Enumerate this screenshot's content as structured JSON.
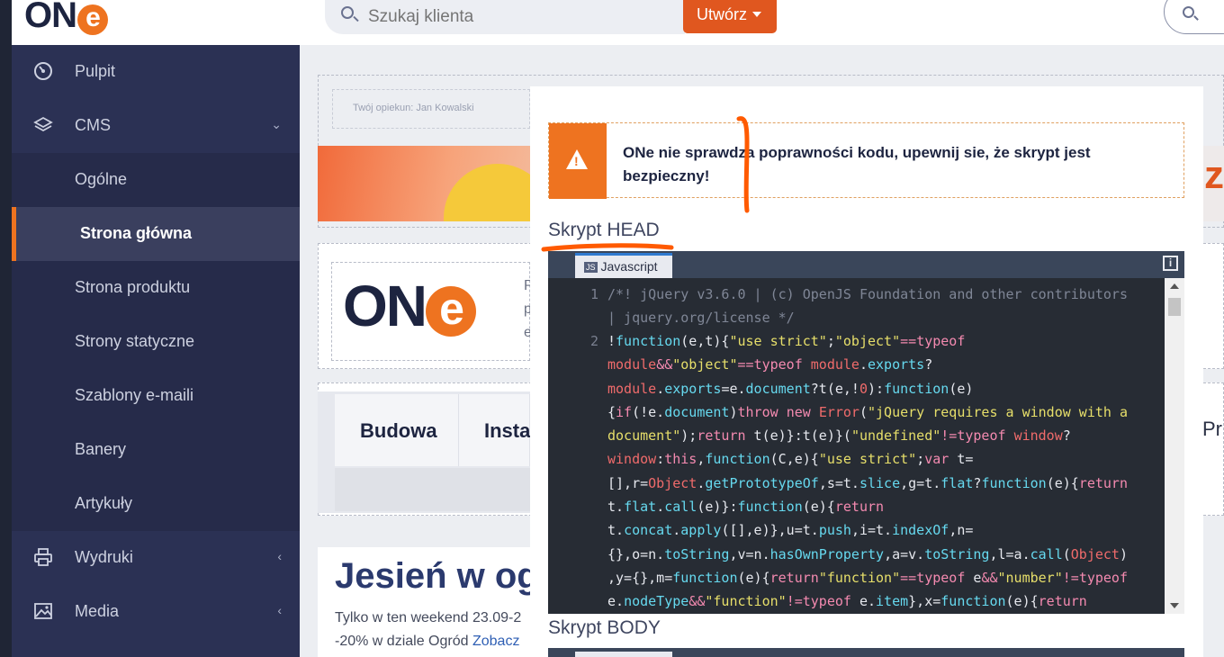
{
  "app": {
    "logo_main": "ON",
    "logo_e": "e"
  },
  "header": {
    "search_placeholder": "Szukaj klienta",
    "create_label": "Utwórz"
  },
  "sidebar": {
    "items": [
      {
        "label": "Pulpit",
        "icon": "dashboard-gauge-icon"
      },
      {
        "label": "CMS",
        "icon": "layers-icon"
      },
      {
        "label": "Ogólne"
      },
      {
        "label": "Strona główna"
      },
      {
        "label": "Strona produktu"
      },
      {
        "label": "Strony statyczne"
      },
      {
        "label": "Szablony e-maili"
      },
      {
        "label": "Banery"
      },
      {
        "label": "Artykuły"
      },
      {
        "label": "Wydruki",
        "icon": "printer-icon"
      },
      {
        "label": "Media",
        "icon": "image-icon"
      }
    ]
  },
  "background": {
    "owner": "Twój opiekun: Jan Kowalski",
    "logo_main": "ON",
    "logo_e": "e",
    "tab_1": "Budowa",
    "tab_2": "Insta",
    "right_fragment": "Pr",
    "side_fragment": "P\np\ne",
    "banner_fragment": "z",
    "promo_title": "Jesień w og",
    "promo_text_1": "Tylko w ten weekend 23.09-2",
    "promo_text_2_prefix": "-20% w dziale Ogród ",
    "promo_link": "Zobacz"
  },
  "modal": {
    "alert_text": "ONe nie sprawdza poprawności kodu, upewnij sie, że skrypt jest bezpieczny!",
    "head_title": "Skrypt HEAD",
    "body_title": "Skrypt BODY",
    "editor_tab": "Javascript",
    "editor_tab_badge": "JS",
    "info_label": "i",
    "line_numbers": [
      "1",
      "2"
    ]
  },
  "colors": {
    "accent": "#ee7320",
    "sidebar": "#2b3154",
    "editor_bg": "#272c34",
    "annotation": "#ff5a00"
  }
}
